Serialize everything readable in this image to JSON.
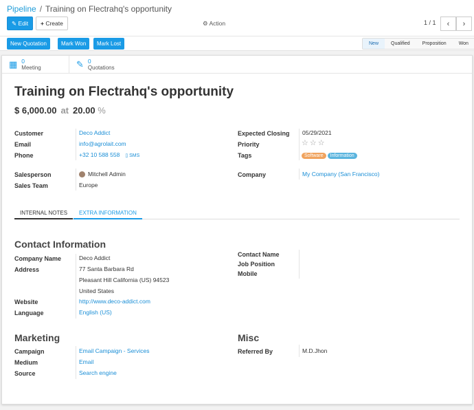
{
  "breadcrumb": {
    "parent": "Pipeline",
    "separator": "/",
    "current": "Training on Flectrahq's opportunity"
  },
  "toolbar": {
    "edit": "Edit",
    "create": "Create",
    "action": "Action",
    "pager": "1 / 1"
  },
  "statusbar": {
    "buttons": [
      "New Quotation",
      "Mark Won",
      "Mark Lost"
    ],
    "stages": [
      "New",
      "Qualified",
      "Proposition",
      "Won"
    ]
  },
  "smart": {
    "meeting_count": "0",
    "meeting_label": "Meeting",
    "quotations_count": "0",
    "quotations_label": "Quotations"
  },
  "form": {
    "title": "Training on Flectrahq's opportunity",
    "revenue": "$ 6,000.00",
    "at": "at",
    "probability": "20.00",
    "percent": "%",
    "left": {
      "customer_label": "Customer",
      "customer": "Deco Addict",
      "email_label": "Email",
      "email": "info@agrolait.com",
      "phone_label": "Phone",
      "phone": "+32 10 588 558",
      "sms": "SMS",
      "salesperson_label": "Salesperson",
      "salesperson": "Mitchell Admin",
      "team_label": "Sales Team",
      "team": "Europe"
    },
    "right": {
      "closing_label": "Expected Closing",
      "closing": "05/29/2021",
      "priority_label": "Priority",
      "priority_stars": 3,
      "tags_label": "Tags",
      "tags": [
        {
          "name": "Software",
          "color": "#f0a35e"
        },
        {
          "name": "Information",
          "color": "#5ab4de"
        }
      ],
      "company_label": "Company",
      "company": "My Company (San Francisco)"
    }
  },
  "tabs": [
    "INTERNAL NOTES",
    "EXTRA INFORMATION"
  ],
  "contact": {
    "heading": "Contact Information",
    "company_name_label": "Company Name",
    "company_name": "Deco Addict",
    "address_label": "Address",
    "address_line1": "77 Santa Barbara Rd",
    "address_line2": "Pleasant Hill  California (US)  94523",
    "address_line3": "United States",
    "website_label": "Website",
    "website": "http://www.deco-addict.com",
    "language_label": "Language",
    "language": "English (US)",
    "contact_name_label": "Contact Name",
    "job_position_label": "Job Position",
    "mobile_label": "Mobile"
  },
  "marketing": {
    "heading": "Marketing",
    "campaign_label": "Campaign",
    "campaign": "Email Campaign - Services",
    "medium_label": "Medium",
    "medium": "Email",
    "source_label": "Source",
    "source": "Search engine"
  },
  "misc": {
    "heading": "Misc",
    "referred_label": "Referred By",
    "referred": "M.D.Jhon"
  }
}
